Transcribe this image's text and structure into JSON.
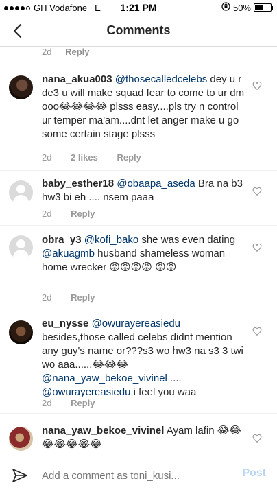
{
  "status": {
    "carrier": "GH Vodafone",
    "network": "E",
    "time": "1:21 PM",
    "battery": "50%",
    "battery_level": 0.5
  },
  "nav": {
    "title": "Comments"
  },
  "top_meta": {
    "time": "2d",
    "reply": "Reply"
  },
  "comments": [
    {
      "user": "nana_akua003",
      "mention": "@thosecalledcelebs",
      "text": " dey u r de3 u will make squad fear to come to ur dm ooo😂😂😂😂 plsss easy....pls try n control ur temper ma'am....dnt let anger make u go some certain stage plsss",
      "time": "2d",
      "likes": "2 likes",
      "reply": "Reply"
    },
    {
      "user": "baby_esther18",
      "mention": "@obaapa_aseda",
      "text": "  Bra na b3 hw3 bi eh .... nsem paaa",
      "time": "2d",
      "reply": "Reply"
    },
    {
      "user": "obra_y3",
      "mention": "@kofi_bako",
      "text_a": "  she was even dating ",
      "mention2": "@akuagmb",
      "text_b": "  husband shameless woman home wrecker 😡😡😡😡 😡😡",
      "time": "2d",
      "reply": "Reply"
    },
    {
      "user": "eu_nysse",
      "mention": "@owurayereasiedu",
      "text_a": " besides,those called celebs didnt mention any guy's name or???s3 wo hw3 na s3 3 twi wo aaa......😂😂😂 ",
      "mention2": "@nana_yaw_bekoe_vivinel",
      "text_b": " .... ",
      "mention3": "@owurayereasiedu",
      "text_c": " i feel you waa",
      "time": "2d",
      "reply": "Reply"
    },
    {
      "user": "nana_yaw_bekoe_vivinel",
      "text": " Ayam lafin 😂😂😂😂😂😂😂"
    }
  ],
  "composer": {
    "placeholder": "Add a comment as toni_kusi...",
    "post": "Post"
  },
  "colors": {
    "mention": "#003569",
    "post_disabled": "#b8d6f3",
    "meta": "#999999"
  }
}
